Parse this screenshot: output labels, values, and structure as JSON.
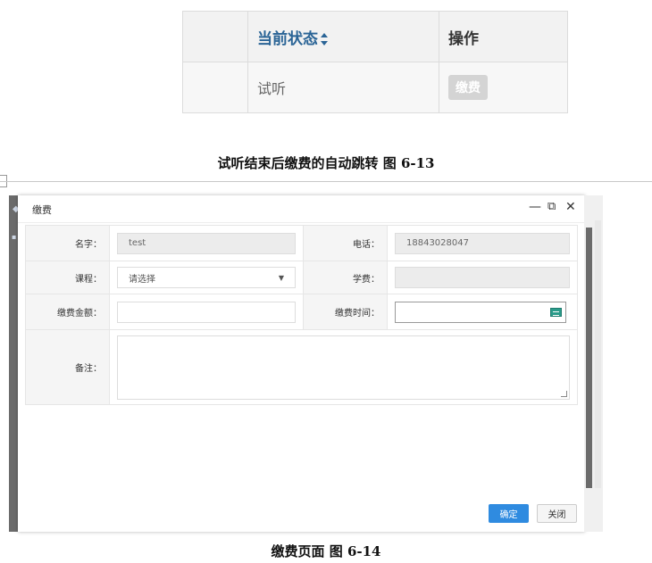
{
  "figure_top": {
    "table": {
      "header": {
        "status": "当前状态",
        "action": "操作"
      },
      "row": {
        "status": "试听",
        "pay_button": "缴费"
      }
    },
    "caption": "试听结束后缴费的自动跳转  图 6-13"
  },
  "dialog": {
    "title": "缴费",
    "fields": {
      "name_label": "名字：",
      "name_value": "test",
      "phone_label": "电话：",
      "phone_value": "18843028047",
      "course_label": "课程：",
      "course_value": "请选择",
      "fee_label": "学费：",
      "fee_value": "",
      "amount_label": "缴费金额：",
      "amount_value": "",
      "time_label": "缴费时间：",
      "time_value": "",
      "note_label": "备注：",
      "note_value": ""
    },
    "buttons": {
      "ok": "确定",
      "close": "关闭"
    }
  },
  "figure_bottom": {
    "caption": "缴费页面    图 6-14"
  },
  "colors": {
    "primary_button": "#2f8be0",
    "header_link": "#2a6496",
    "calendar_icon": "#2a9b8a"
  },
  "icons": [
    "sort-icon",
    "minimize-icon",
    "maximize-icon",
    "close-icon",
    "dropdown-arrow-icon",
    "calendar-icon",
    "resize-handle-icon"
  ]
}
